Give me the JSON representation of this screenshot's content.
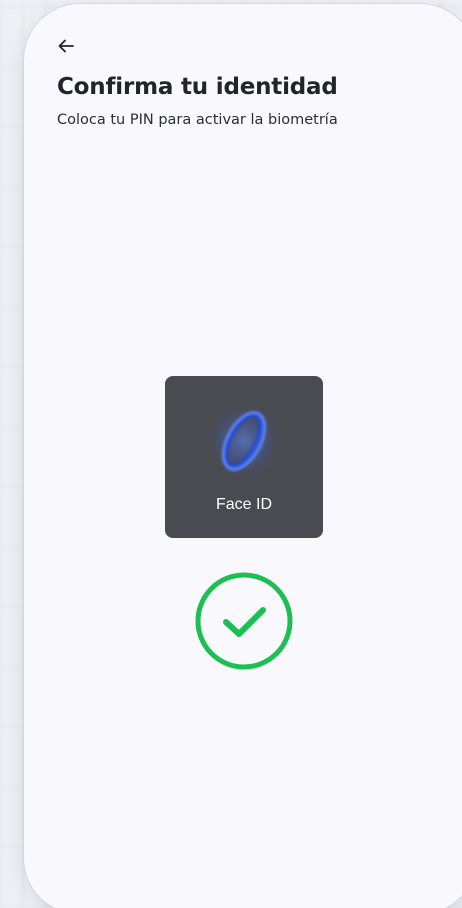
{
  "header": {
    "back_icon": "arrow-left-icon",
    "title": "Confirma tu identidad",
    "subtitle": "Coloca tu PIN para activar la biometría"
  },
  "biometric": {
    "label": "Face ID",
    "icon": "face-id-ring-icon"
  },
  "status": {
    "icon": "check-circle-icon",
    "color": "#1dbf55"
  },
  "colors": {
    "card_bg": "#4a4b50",
    "screen_bg": "#f8f8fd",
    "faceid_glow": "#2f6bff"
  }
}
